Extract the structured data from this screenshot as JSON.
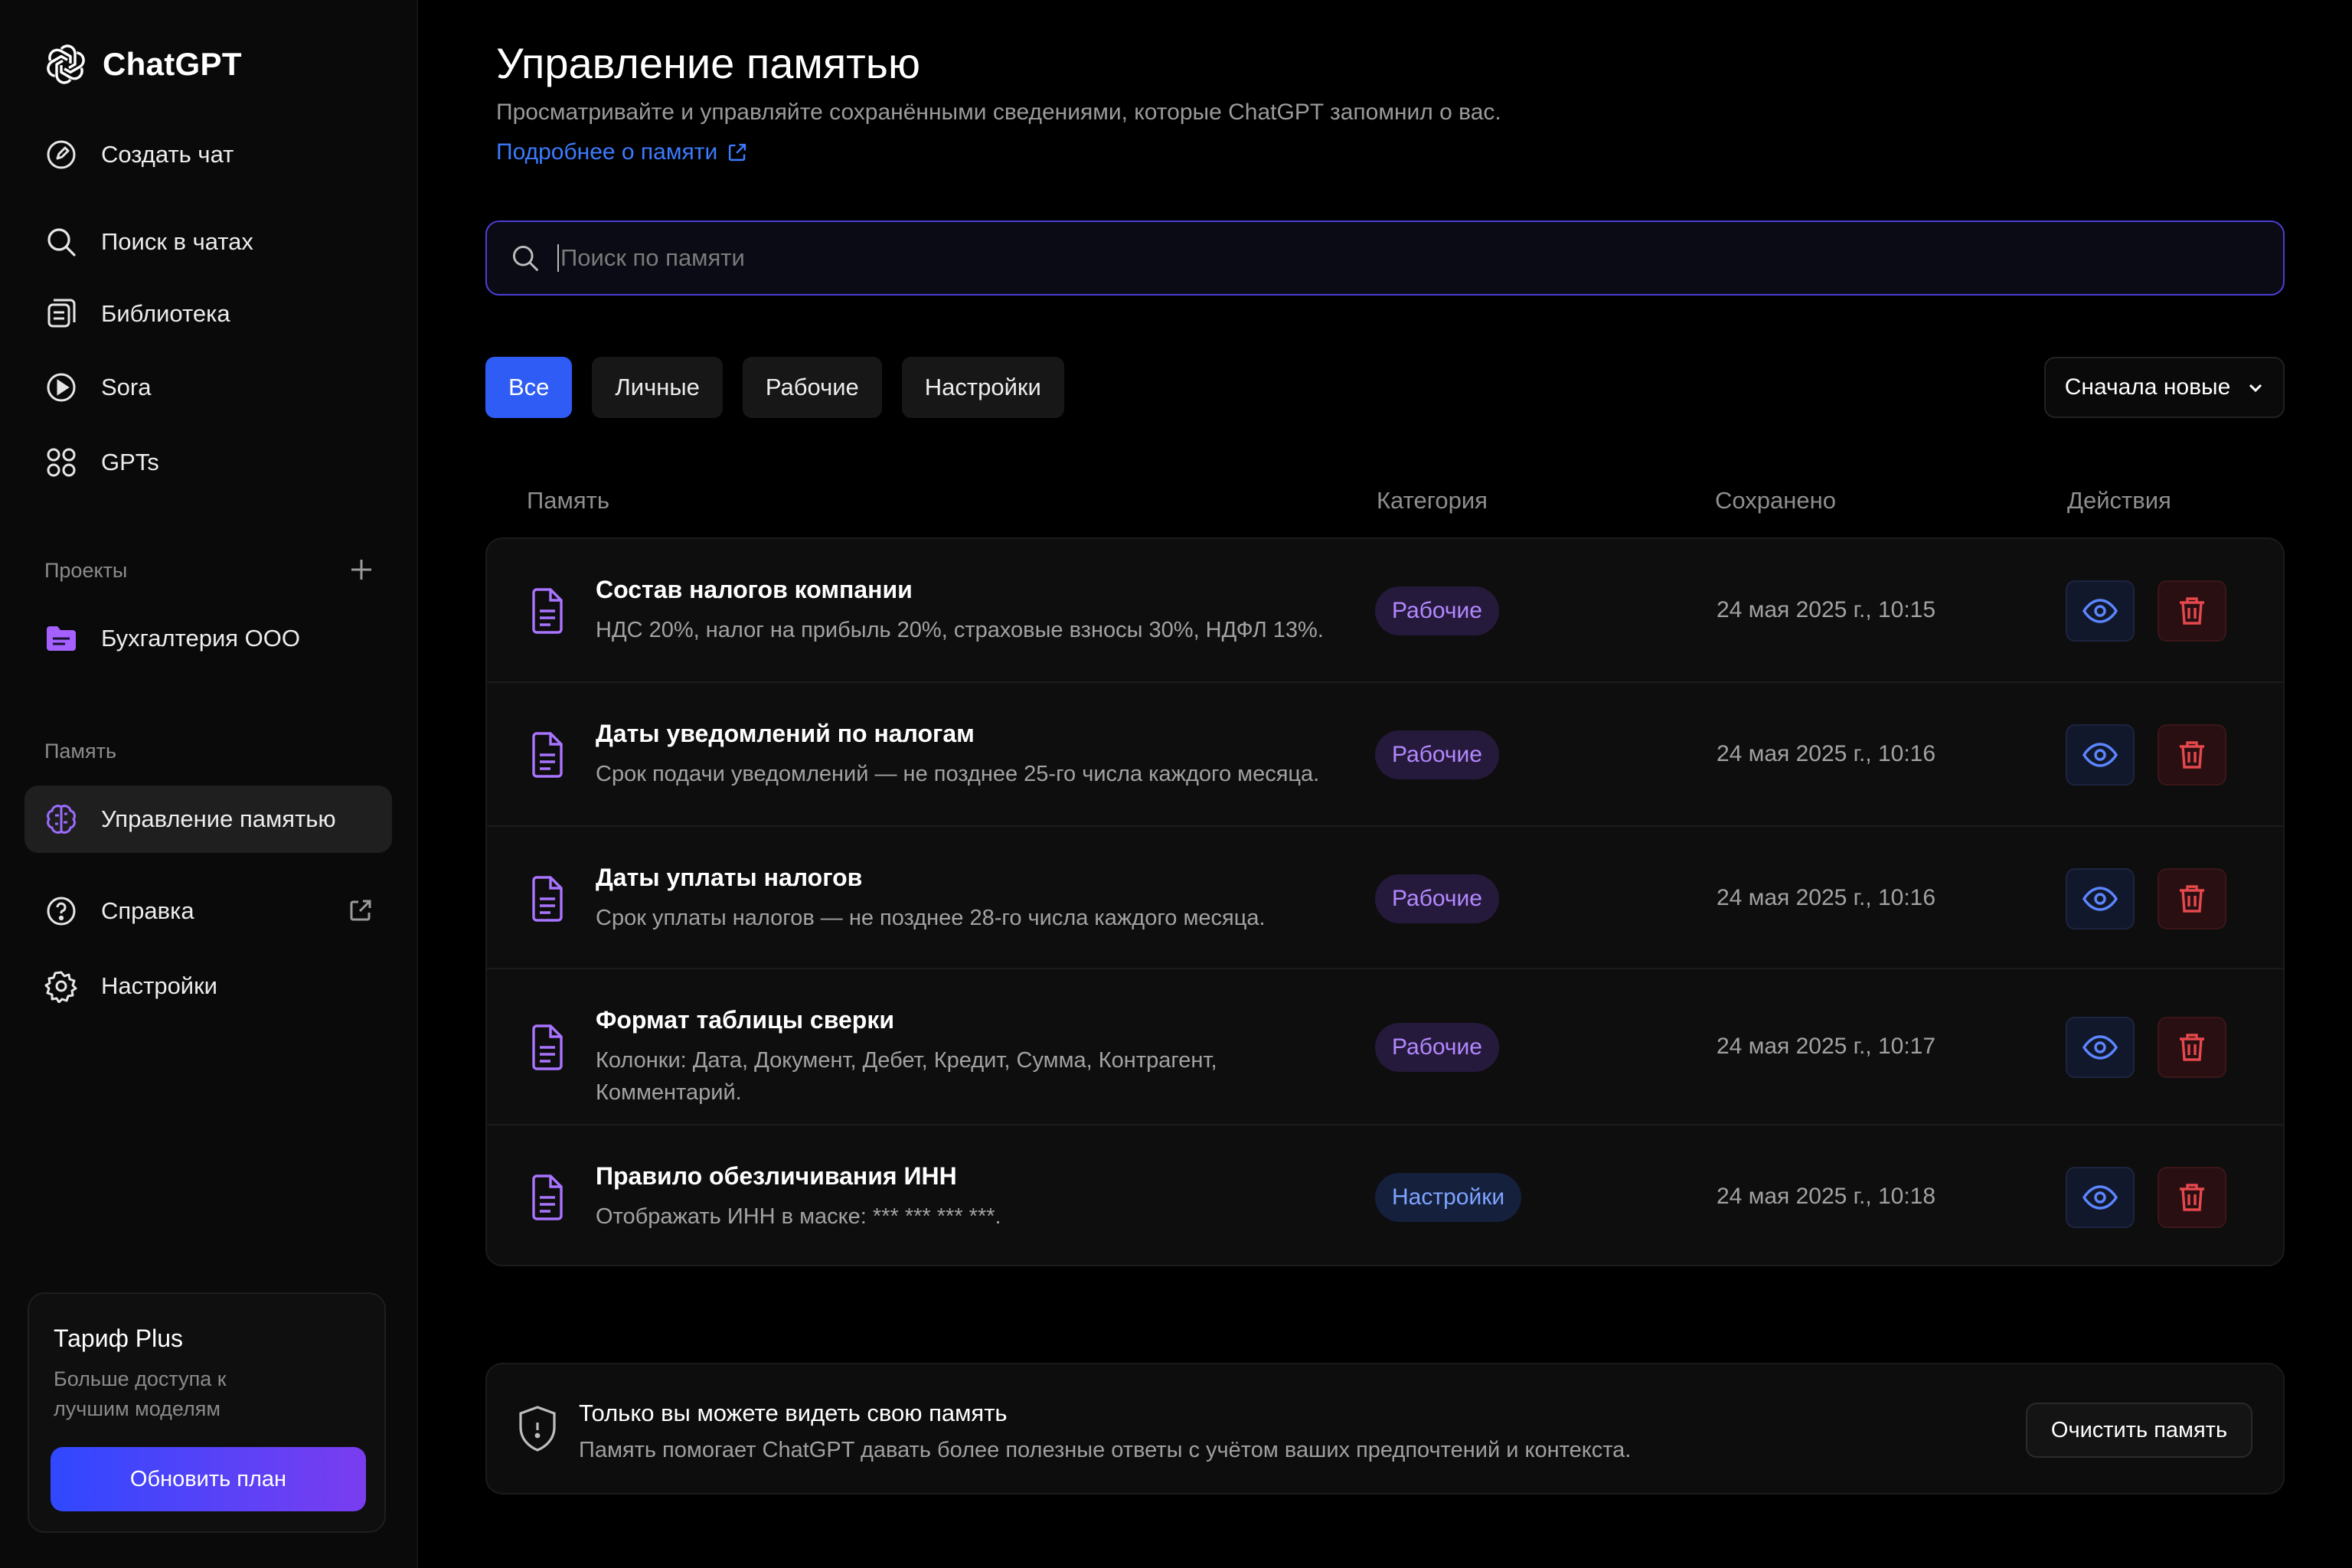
{
  "sidebar": {
    "brand": "ChatGPT",
    "nav": [
      {
        "label": "Создать чат",
        "icon": "new-chat-icon"
      },
      {
        "label": "Поиск в чатах",
        "icon": "search-icon"
      },
      {
        "label": "Библиотека",
        "icon": "library-icon"
      },
      {
        "label": "Sora",
        "icon": "sora-icon"
      },
      {
        "label": "GPTs",
        "icon": "gpts-icon"
      }
    ],
    "projects_label": "Проекты",
    "project": "Бухгалтерия ООО",
    "memory_label": "Память",
    "memory_item": "Управление памятью",
    "help": "Справка",
    "settings": "Настройки",
    "plan": {
      "title": "Тариф Plus",
      "desc": "Больше доступа к лучшим моделям",
      "button": "Обновить план"
    }
  },
  "main": {
    "title": "Управление памятью",
    "subtitle": "Просматривайте и управляйте сохранёнными сведениями, которые ChatGPT запомнил о вас.",
    "link": "Подробнее о памяти",
    "search_placeholder": "Поиск по памяти",
    "tabs": [
      "Все",
      "Личные",
      "Рабочие",
      "Настройки"
    ],
    "active_tab": "Все",
    "sort": "Сначала новые",
    "columns": [
      "Память",
      "Категория",
      "Сохранено",
      "Действия"
    ],
    "rows": [
      {
        "title": "Состав налогов компании",
        "desc": "НДС 20%, налог на прибыль 20%, страховые взносы 30%, НДФЛ 13%.",
        "category": "Рабочие",
        "date": "24 мая 2025 г., 10:15"
      },
      {
        "title": "Даты уведомлений по налогам",
        "desc": "Срок подачи уведомлений — не позднее 25-го числа каждого месяца.",
        "category": "Рабочие",
        "date": "24 мая 2025 г., 10:16"
      },
      {
        "title": "Даты уплаты налогов",
        "desc": "Срок уплаты налогов — не позднее 28-го числа каждого месяца.",
        "category": "Рабочие",
        "date": "24 мая 2025 г., 10:16"
      },
      {
        "title": "Формат таблицы сверки",
        "desc": "Колонки: Дата, Документ, Дебет, Кредит, Сумма, Контрагент, Комментарий.",
        "category": "Рабочие",
        "date": "24 мая 2025 г., 10:17"
      },
      {
        "title": "Правило обезличивания ИНН",
        "desc": "Отображать ИНН в маске: *** *** *** ***.",
        "category": "Настройки",
        "date": "24 мая 2025 г., 10:18"
      }
    ],
    "privacy": {
      "title": "Только вы можете видеть свою память",
      "desc": "Память помогает ChatGPT давать более полезные ответы с учётом ваших предпочтений и контекста.",
      "button": "Очистить память"
    }
  },
  "colors": {
    "accent": "#2f5cf5",
    "work_badge": "#b388ff",
    "settings_badge": "#7ea3ff",
    "delete": "#e5484d",
    "view": "#5b86ff",
    "doc_icon": "#a974ff"
  }
}
